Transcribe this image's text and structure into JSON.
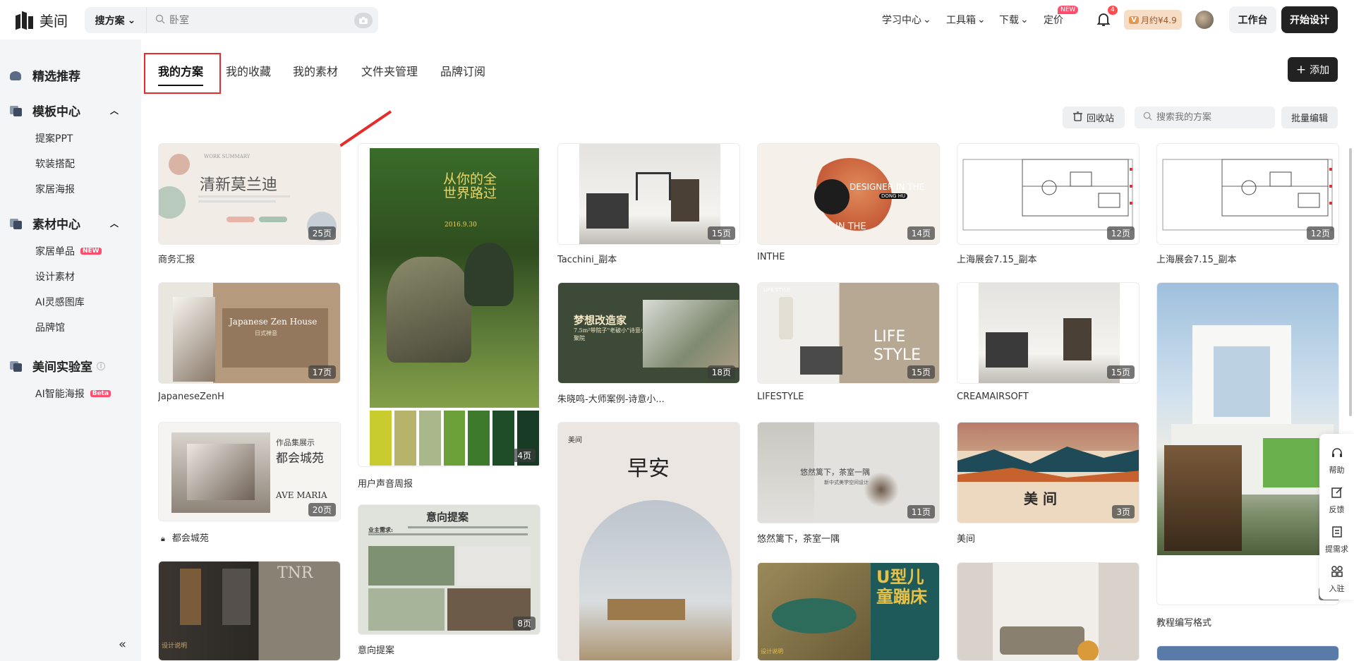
{
  "app": {
    "name": "美间"
  },
  "search": {
    "scope": "搜方案",
    "placeholder": "卧室"
  },
  "nav": {
    "learn": "学习中心",
    "tools": "工具箱",
    "download": "下载",
    "pricing": "定价",
    "new_badge": "NEW"
  },
  "notifications": {
    "count": "4"
  },
  "vip": {
    "label": "月约¥4.9",
    "mark": "V"
  },
  "buttons": {
    "workbench": "工作台",
    "start_design": "开始设计",
    "add": "添加",
    "recycle": "回收站",
    "batch_edit": "批量编辑",
    "add_icon": "+"
  },
  "sidebar": {
    "featured": "精选推荐",
    "template_center": "模板中心",
    "template_items": [
      "提案PPT",
      "软装搭配",
      "家居海报"
    ],
    "material_center": "素材中心",
    "material_items": [
      "家居单品",
      "设计素材",
      "AI灵感图库",
      "品牌馆"
    ],
    "material_badge": "NEW",
    "lab": "美间实验室",
    "lab_items": [
      "AI智能海报"
    ],
    "lab_badge": "Beta",
    "collapse": "«"
  },
  "tabs": [
    "我的方案",
    "我的收藏",
    "我的素材",
    "文件夹管理",
    "品牌订阅"
  ],
  "my_search": {
    "placeholder": "搜索我的方案"
  },
  "cards": [
    {
      "title": "商务汇报",
      "pages": "25页",
      "cover_text": "清新莫兰迪",
      "cover_sub": "WORK SUMMARY"
    },
    {
      "title": "JapaneseZenH",
      "pages": "17页",
      "cover_text": "Japanese Zen House",
      "cover_sub": "日式禅意"
    },
    {
      "title": "都会城苑",
      "pages": "20页",
      "cover_text": "都会城苑",
      "cover_sub": "作品集展示",
      "cover_sub2": "AVE MARIA"
    },
    {
      "title": "",
      "pages": "",
      "cover_text": "TNR",
      "cover_sub": "设计说明"
    },
    {
      "title": "用户声音周报",
      "pages": "4页",
      "cover_text": "从你的全世界路过",
      "cover_sub": "2016.9.30"
    },
    {
      "title": "意向提案",
      "pages": "8页",
      "cover_text": "意向提案",
      "cover_sub": "业主需求:"
    },
    {
      "title": "Tacchini_副本",
      "pages": "15页"
    },
    {
      "title": "朱晓鸣-大师案例-诗意小...",
      "pages": "18页",
      "cover_text": "梦想改造家",
      "cover_sub": "7.5m²带院子\"老破小\"诗意小聚院"
    },
    {
      "title": "",
      "pages": "",
      "cover_text": "早安",
      "cover_sub": "美间"
    },
    {
      "title": "INTHE",
      "pages": "14页",
      "cover_text": "DESIGNER IN THE",
      "cover_sub": "IN THE",
      "cover_tag": "DONG HU"
    },
    {
      "title": "LIFESTYLE",
      "pages": "15页",
      "cover_text": "LIFE STYLE",
      "cover_sub": "LIFE STYLE"
    },
    {
      "title": "悠然篱下，茶室一隅",
      "pages": "11页",
      "cover_text": "悠然篱下，茶室一隅",
      "cover_sub": "新中式美学空间设计"
    },
    {
      "title": "",
      "pages": "",
      "cover_text": "U型儿童蹦床",
      "cover_sub": "设计说明"
    },
    {
      "title": "上海展会7.15_副本",
      "pages": "12页"
    },
    {
      "title": "CREAMAIRSOFT",
      "pages": "15页"
    },
    {
      "title": "美间",
      "pages": "3页",
      "cover_text": "美 间"
    },
    {
      "title": "",
      "pages": ""
    },
    {
      "title": "上海展会7.15_副本",
      "pages": "12页"
    },
    {
      "title": "教程编写格式",
      "pages": "2页"
    }
  ],
  "rail": {
    "help": "帮助",
    "feedback": "反馈",
    "request": "提需求",
    "join": "入驻"
  }
}
